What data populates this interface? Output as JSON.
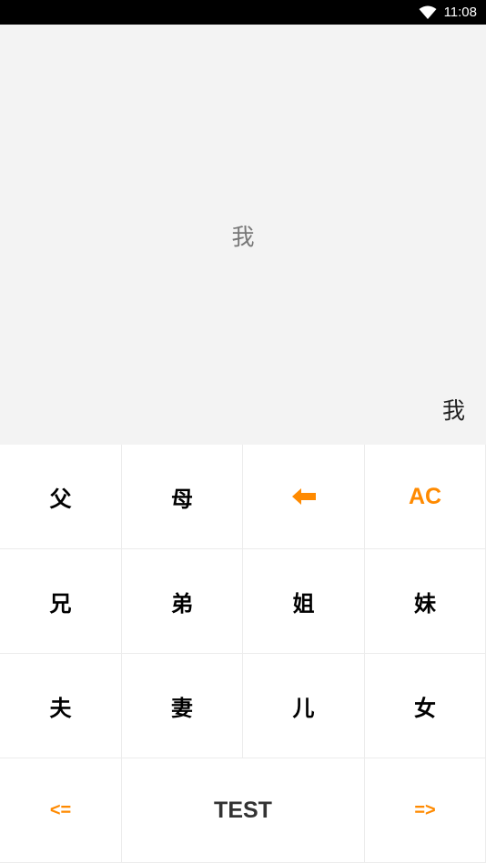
{
  "status_bar": {
    "time": "11:08",
    "icons": [
      "wifi-icon"
    ],
    "background": "#000000"
  },
  "display": {
    "expression": "我",
    "result": "我",
    "background": "#f3f3f3"
  },
  "keypad": {
    "accent_color": "#ff8a00",
    "keys": {
      "father": "父",
      "mother": "母",
      "backspace_icon": "backspace-arrow-icon",
      "clear": "AC",
      "elder_brother": "兄",
      "younger_brother": "弟",
      "elder_sister": "姐",
      "younger_sister": "妹",
      "husband": "夫",
      "wife": "妻",
      "son": "儿",
      "daughter": "女",
      "prev": "<=",
      "test": "TEST",
      "next": "=>"
    }
  }
}
